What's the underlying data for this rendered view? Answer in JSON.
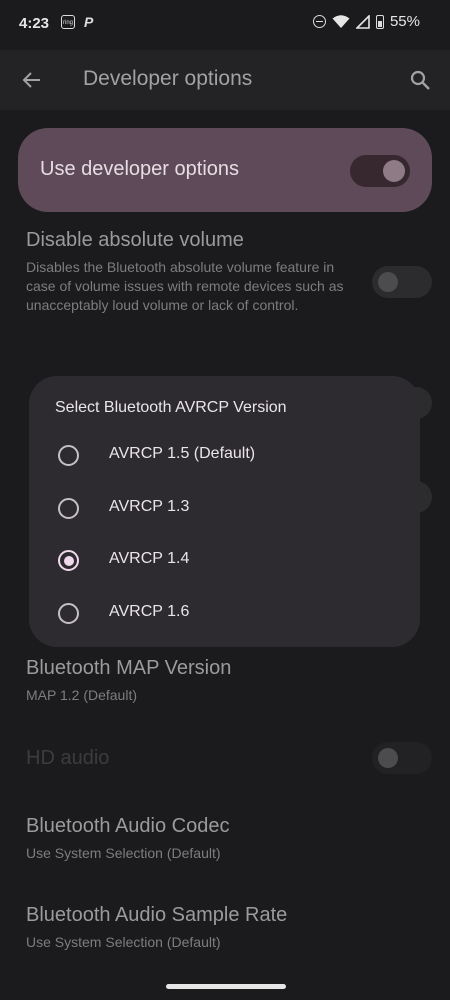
{
  "status": {
    "time": "4:23",
    "ring_icon_text": "ring",
    "battery": "55%"
  },
  "topbar": {
    "title": "Developer options"
  },
  "master": {
    "label": "Use developer options",
    "on": true
  },
  "prefs": [
    {
      "title": "Disable absolute volume",
      "summary": "Disables the Bluetooth absolute volume feature in case of volume issues with remote devices such as unacceptably loud volume or lack of control."
    },
    {
      "title": "Bluetooth MAP Version",
      "summary": "MAP 1.2 (Default)"
    },
    {
      "title": "HD audio",
      "summary": ""
    },
    {
      "title": "Bluetooth Audio Codec",
      "summary": "Use System Selection (Default)"
    },
    {
      "title": "Bluetooth Audio Sample Rate",
      "summary": "Use System Selection (Default)"
    }
  ],
  "dialog": {
    "title": "Select Bluetooth AVRCP Version",
    "options": [
      "AVRCP 1.5 (Default)",
      "AVRCP 1.3",
      "AVRCP 1.4",
      "AVRCP 1.6"
    ],
    "selected": "AVRCP 1.4"
  },
  "colors": {
    "accent": "#f1d9ec",
    "master_bg": "#5f4a59",
    "dialog_bg": "#2e2b30"
  }
}
